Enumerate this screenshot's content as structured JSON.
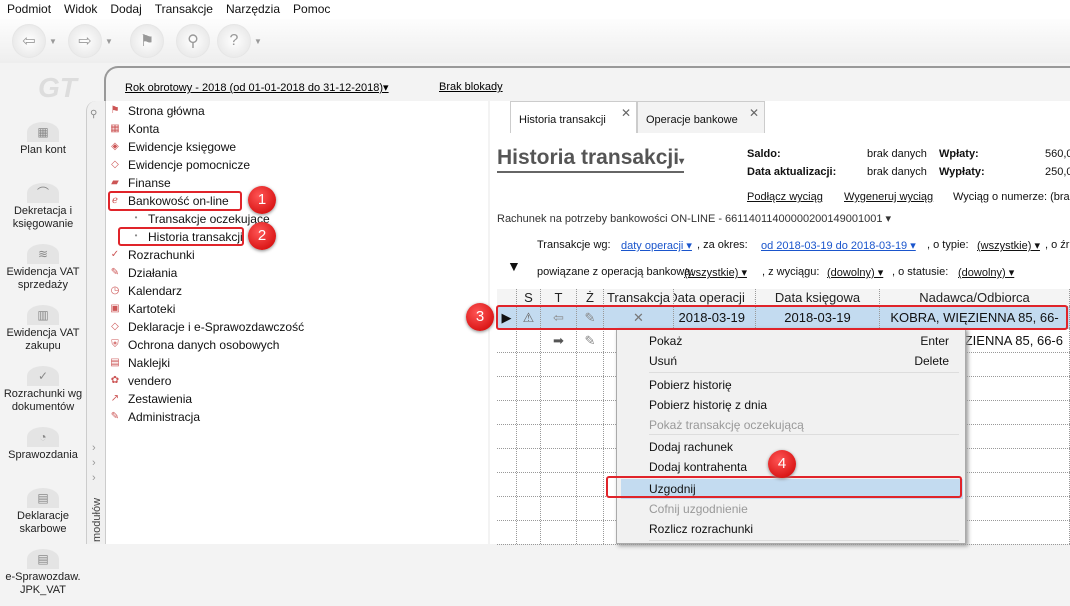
{
  "menu": [
    "Podmiot",
    "Widok",
    "Dodaj",
    "Transakcje",
    "Narzędzia",
    "Pomoc"
  ],
  "topbar": {
    "year": "Rok obrotowy - 2018  (od 01-01-2018 do 31-12-2018)▾",
    "lock": "Brak blokady"
  },
  "logo": "GT",
  "leftnav": [
    "Plan kont",
    "Dekretacja i księgowanie",
    "Ewidencja VAT sprzedaży",
    "Ewidencja VAT zakupu",
    "Rozrachunki wg dokumentów",
    "Sprawozdania",
    "Deklaracje skarbowe",
    "e-Sprawozdaw. JPK_VAT"
  ],
  "strip_label": "modułów",
  "tree": [
    "Strona główna",
    "Konta",
    "Ewidencje księgowe",
    "Ewidencje pomocnicze",
    "Finanse",
    "Bankowość on-line",
    "Transakcje oczekujące",
    "Historia transakcji",
    "Rozrachunki",
    "Działania",
    "Kalendarz",
    "Kartoteki",
    "Deklaracje i e-Sprawozdawczość",
    "Ochrona danych osobowych",
    "Naklejki",
    "vendero",
    "Zestawienia",
    "Administracja"
  ],
  "badges": [
    "1",
    "2",
    "3",
    "4"
  ],
  "tabs": [
    "Historia transakcji",
    "Operacje bankowe"
  ],
  "header": {
    "title": "Historia transakcji",
    "saldo_l": "Saldo:",
    "saldo": "brak danych",
    "data_l": "Data aktualizacji:",
    "data": "brak danych",
    "wplaty_l": "Wpłaty:",
    "wplaty": "560,0",
    "wyplaty_l": "Wypłaty:",
    "wyplaty": "250,0",
    "podlacz": "Podłącz wyciąg",
    "wygeneruj": "Wygeneruj wyciąg",
    "wyciag": "Wyciąg o numerze: (brak"
  },
  "account": "Rachunek na potrzeby bankowości ON-LINE - 66114011400000200149001001 ▾",
  "filters": {
    "wg_l": "Transakcje wg:",
    "wg": "daty operacji ▾",
    "okres_l": ", za okres:",
    "okres": "od 2018-03-19 do 2018-03-19 ▾",
    "typ_l": ", o typie:",
    "typ": "(wszystkie) ▾",
    "zr_l": ", o źr",
    "pow_l": "powiązane z operacją bankową:",
    "pow": "(wszystkie) ▾",
    "wyc_l": ", z wyciągu:",
    "wyc": "(dowolny) ▾",
    "stat_l": ", o statusie:",
    "stat": "(dowolny) ▾"
  },
  "grid": {
    "columns": [
      "",
      "S",
      "T",
      "Ż",
      "Transakcja",
      "Data operacji",
      "Data księgowa",
      "Nadawca/Odbiorca"
    ],
    "rows": [
      {
        "data_op": "2018-03-19",
        "data_ks": "2018-03-19",
        "nadawca": "KOBRA, WIĘZIENNA 85,  66-"
      },
      {
        "data_op": "",
        "data_ks": "",
        "nadawca": "ZIENNA 85, 66-6"
      }
    ]
  },
  "context_menu": [
    {
      "label": "Pokaż",
      "key": "Enter"
    },
    {
      "label": "Usuń",
      "key": "Delete"
    },
    {
      "label": "Pobierz historię"
    },
    {
      "label": "Pobierz historię z dnia"
    },
    {
      "label": "Pokaż transakcję oczekującą"
    },
    {
      "label": "Dodaj rachunek"
    },
    {
      "label": "Dodaj kontrahenta"
    },
    {
      "label": "Uzgodnij"
    },
    {
      "label": "Cofnij uzgodnienie"
    },
    {
      "label": "Rozlicz rozrachunki"
    }
  ]
}
